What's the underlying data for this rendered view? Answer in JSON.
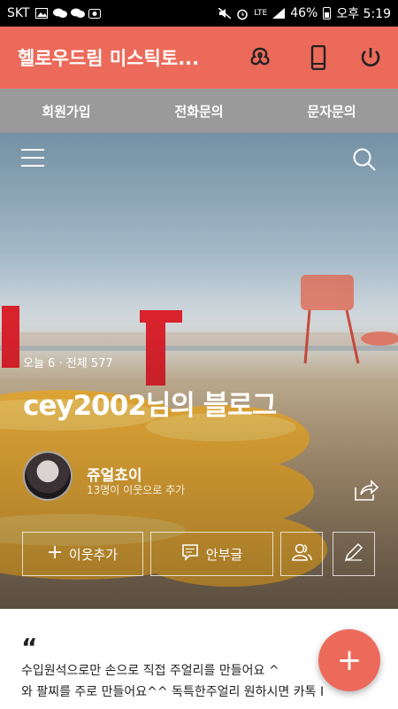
{
  "status_bar": {
    "carrier": "SKT",
    "battery": "46%",
    "time": "오후 5:19",
    "network": "LTE"
  },
  "header": {
    "title": "헬로우드림 미스틱토..."
  },
  "menu": [
    {
      "label": "회원가입"
    },
    {
      "label": "전화문의"
    },
    {
      "label": "문자문의"
    }
  ],
  "hero": {
    "today_label": "오늘 6",
    "separator": "·",
    "total_label": "전체 577",
    "blog_title": "cey2002님의 블로그",
    "nickname": "쥬얼쵸이",
    "neighbors": "13명이 이웃으로 추가",
    "add_neighbor_label": "이웃추가",
    "guestbook_label": "안부글"
  },
  "intro": {
    "quote": "“",
    "line1": "수입원석으로만 손으로 직접 주얼리를 만들어요 ^",
    "line2": "와 팔찌를 주로 만들어요^^ 독특한주얼리 원하시면 카톡 I"
  },
  "fab": {
    "label": "+"
  },
  "colors": {
    "accent": "#ec6a5a",
    "menu_bg": "#9a9a9a"
  }
}
